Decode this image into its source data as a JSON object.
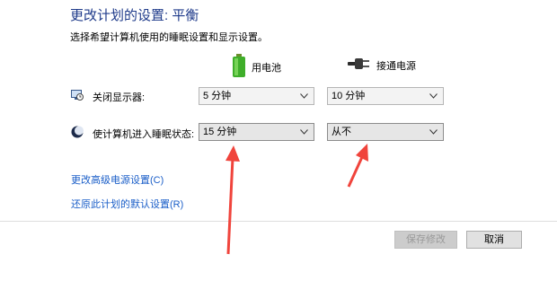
{
  "header": {
    "title": "更改计划的设置: 平衡",
    "subtitle": "选择希望计算机使用的睡眠设置和显示设置。"
  },
  "columns": {
    "battery_label": "用电池",
    "plugged_label": "接通电源",
    "battery_icon": "battery-icon",
    "plug_icon": "power-plug-icon"
  },
  "rows": [
    {
      "label": "关闭显示器:",
      "icon": "monitor-clock-icon",
      "battery_value": "5 分钟",
      "plugged_value": "10 分钟"
    },
    {
      "label": "使计算机进入睡眠状态:",
      "icon": "moon-sleep-icon",
      "battery_value": "15 分钟",
      "plugged_value": "从不"
    }
  ],
  "links": {
    "advanced": "更改高级电源设置(C)",
    "restore": "还原此计划的默认设置(R)"
  },
  "buttons": {
    "save": "保存修改",
    "cancel": "取消"
  },
  "colors": {
    "title": "#1e3a8a",
    "link": "#1a5ec8",
    "annotation_arrow": "#f0443c"
  }
}
